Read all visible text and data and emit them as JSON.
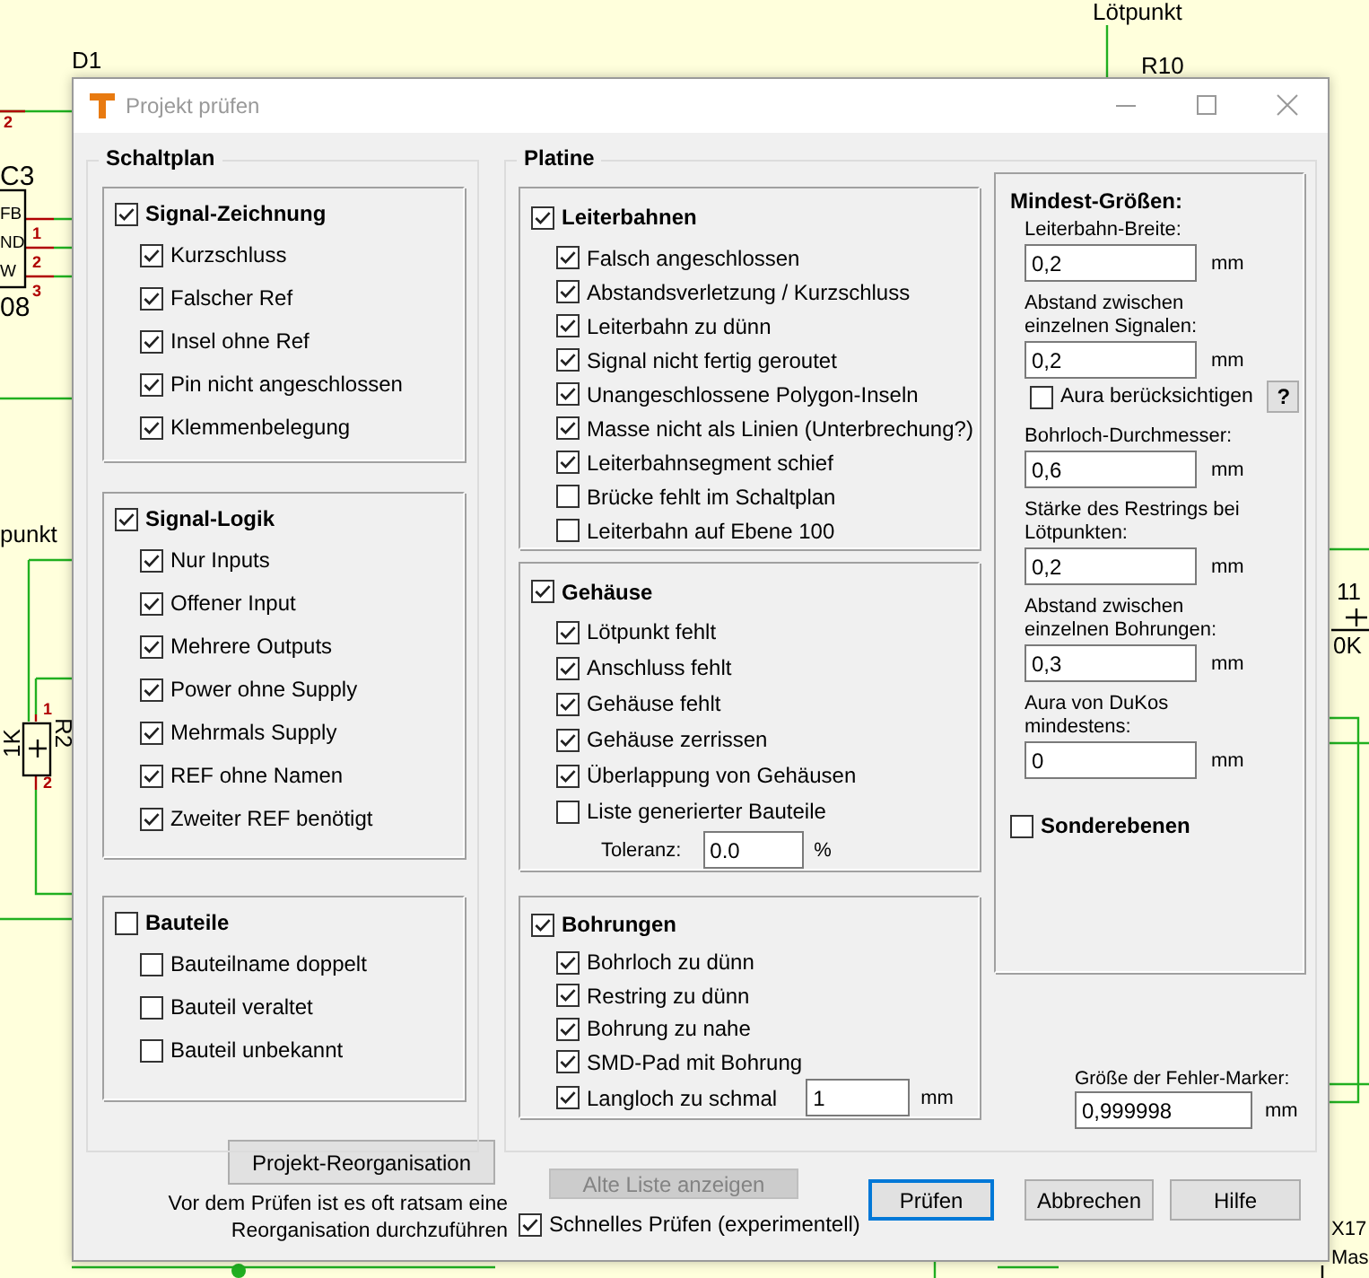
{
  "schematic": {
    "labels": [
      {
        "text": "Lötpunkt"
      },
      {
        "text": "D1"
      },
      {
        "text": "R10"
      },
      {
        "text": "C3"
      },
      {
        "text": "FB"
      },
      {
        "text": "ND"
      },
      {
        "text": "W"
      },
      {
        "text": "08"
      },
      {
        "text": "punkt"
      },
      {
        "text": "1K"
      },
      {
        "text": "R2"
      },
      {
        "text": "11"
      },
      {
        "text": "0K"
      },
      {
        "text": "X17"
      },
      {
        "text": "Mas"
      }
    ],
    "pins": [
      "2",
      "1",
      "2",
      "3",
      "1",
      "2"
    ]
  },
  "window": {
    "title": "Projekt prüfen",
    "active": false
  },
  "schaltplan": {
    "title": "Schaltplan",
    "groups": [
      {
        "title": "Signal-Zeichnung",
        "checked": true,
        "items": [
          {
            "label": "Kurzschluss",
            "checked": true
          },
          {
            "label": "Falscher Ref",
            "checked": true
          },
          {
            "label": "Insel ohne Ref",
            "checked": true
          },
          {
            "label": "Pin nicht angeschlossen",
            "checked": true
          },
          {
            "label": "Klemmenbelegung",
            "checked": true
          }
        ]
      },
      {
        "title": "Signal-Logik",
        "checked": true,
        "items": [
          {
            "label": "Nur Inputs",
            "checked": true
          },
          {
            "label": "Offener Input",
            "checked": true
          },
          {
            "label": "Mehrere Outputs",
            "checked": true
          },
          {
            "label": "Power ohne Supply",
            "checked": true
          },
          {
            "label": "Mehrmals Supply",
            "checked": true
          },
          {
            "label": "REF ohne Namen",
            "checked": true
          },
          {
            "label": "Zweiter REF benötigt",
            "checked": true
          }
        ]
      },
      {
        "title": "Bauteile",
        "checked": false,
        "items": [
          {
            "label": "Bauteilname doppelt",
            "checked": false
          },
          {
            "label": "Bauteil veraltet",
            "checked": false
          },
          {
            "label": "Bauteil unbekannt",
            "checked": false
          }
        ]
      }
    ]
  },
  "reorganize_button": "Projekt-Reorganisation",
  "reorganize_hint": "Vor dem Prüfen ist es oft ratsam eine Reorganisation durchzuführen",
  "platine": {
    "title": "Platine",
    "groups": [
      {
        "title": "Leiterbahnen",
        "checked": true,
        "items": [
          {
            "label": "Falsch angeschlossen",
            "checked": true
          },
          {
            "label": "Abstandsverletzung / Kurzschluss",
            "checked": true
          },
          {
            "label": "Leiterbahn zu dünn",
            "checked": true
          },
          {
            "label": "Signal nicht fertig geroutet",
            "checked": true
          },
          {
            "label": "Unangeschlossene Polygon-Inseln",
            "checked": true
          },
          {
            "label": "Masse nicht als Linien (Unterbrechung?)",
            "checked": true
          },
          {
            "label": "Leiterbahnsegment schief",
            "checked": true
          },
          {
            "label": "Brücke fehlt im Schaltplan",
            "checked": false
          },
          {
            "label": "Leiterbahn auf Ebene 100",
            "checked": false
          }
        ]
      },
      {
        "title": "Gehäuse",
        "checked": true,
        "items": [
          {
            "label": "Lötpunkt fehlt",
            "checked": true
          },
          {
            "label": "Anschluss fehlt",
            "checked": true
          },
          {
            "label": "Gehäuse fehlt",
            "checked": true
          },
          {
            "label": "Gehäuse zerrissen",
            "checked": true
          },
          {
            "label": "Überlappung von Gehäusen",
            "checked": true
          },
          {
            "label": "Liste generierter Bauteile",
            "checked": false
          }
        ],
        "field": {
          "label": "Toleranz:",
          "value": "0.0",
          "unit": "%"
        }
      },
      {
        "title": "Bohrungen",
        "checked": true,
        "items": [
          {
            "label": "Bohrloch zu dünn",
            "checked": true
          },
          {
            "label": "Restring zu dünn",
            "checked": true
          },
          {
            "label": "Bohrung zu nahe",
            "checked": true
          },
          {
            "label": "SMD-Pad mit Bohrung",
            "checked": true
          },
          {
            "label": "Langloch zu schmal",
            "checked": true,
            "value": "1",
            "unit": "mm"
          }
        ]
      }
    ],
    "minimums": {
      "title": "Mindest-Größen:",
      "rows": [
        {
          "kind": "field",
          "label": "Leiterbahn-Breite:",
          "value": "0,2",
          "unit": "mm"
        },
        {
          "kind": "field",
          "label": "Abstand zwischen einzelnen Signalen:",
          "value": "0,2",
          "unit": "mm"
        },
        {
          "kind": "checkbox",
          "label": "Aura berücksichtigen",
          "checked": false,
          "help": "?"
        },
        {
          "kind": "field",
          "label": "Bohrloch-Durchmesser:",
          "value": "0,6",
          "unit": "mm"
        },
        {
          "kind": "field",
          "label": "Stärke des Restrings bei Lötpunkten:",
          "value": "0,2",
          "unit": "mm"
        },
        {
          "kind": "field",
          "label": "Abstand zwischen einzelnen Bohrungen:",
          "value": "0,3",
          "unit": "mm"
        },
        {
          "kind": "field",
          "label": "Aura von DuKos mindestens:",
          "value": "0",
          "unit": "mm"
        }
      ]
    },
    "special_layers": {
      "label": "Sonderebenen",
      "checked": false
    },
    "marker_size": {
      "label": "Größe der Fehler-Marker:",
      "value": "0,999998",
      "unit": "mm"
    }
  },
  "old_list_button": {
    "label": "Alte Liste anzeigen",
    "disabled": true
  },
  "quick_check": {
    "label": "Schnelles Prüfen (experimentell)",
    "checked": true
  },
  "buttons": [
    {
      "label": "Prüfen",
      "default": true
    },
    {
      "label": "Abbrechen",
      "default": false
    },
    {
      "label": "Hilfe",
      "default": false
    }
  ]
}
